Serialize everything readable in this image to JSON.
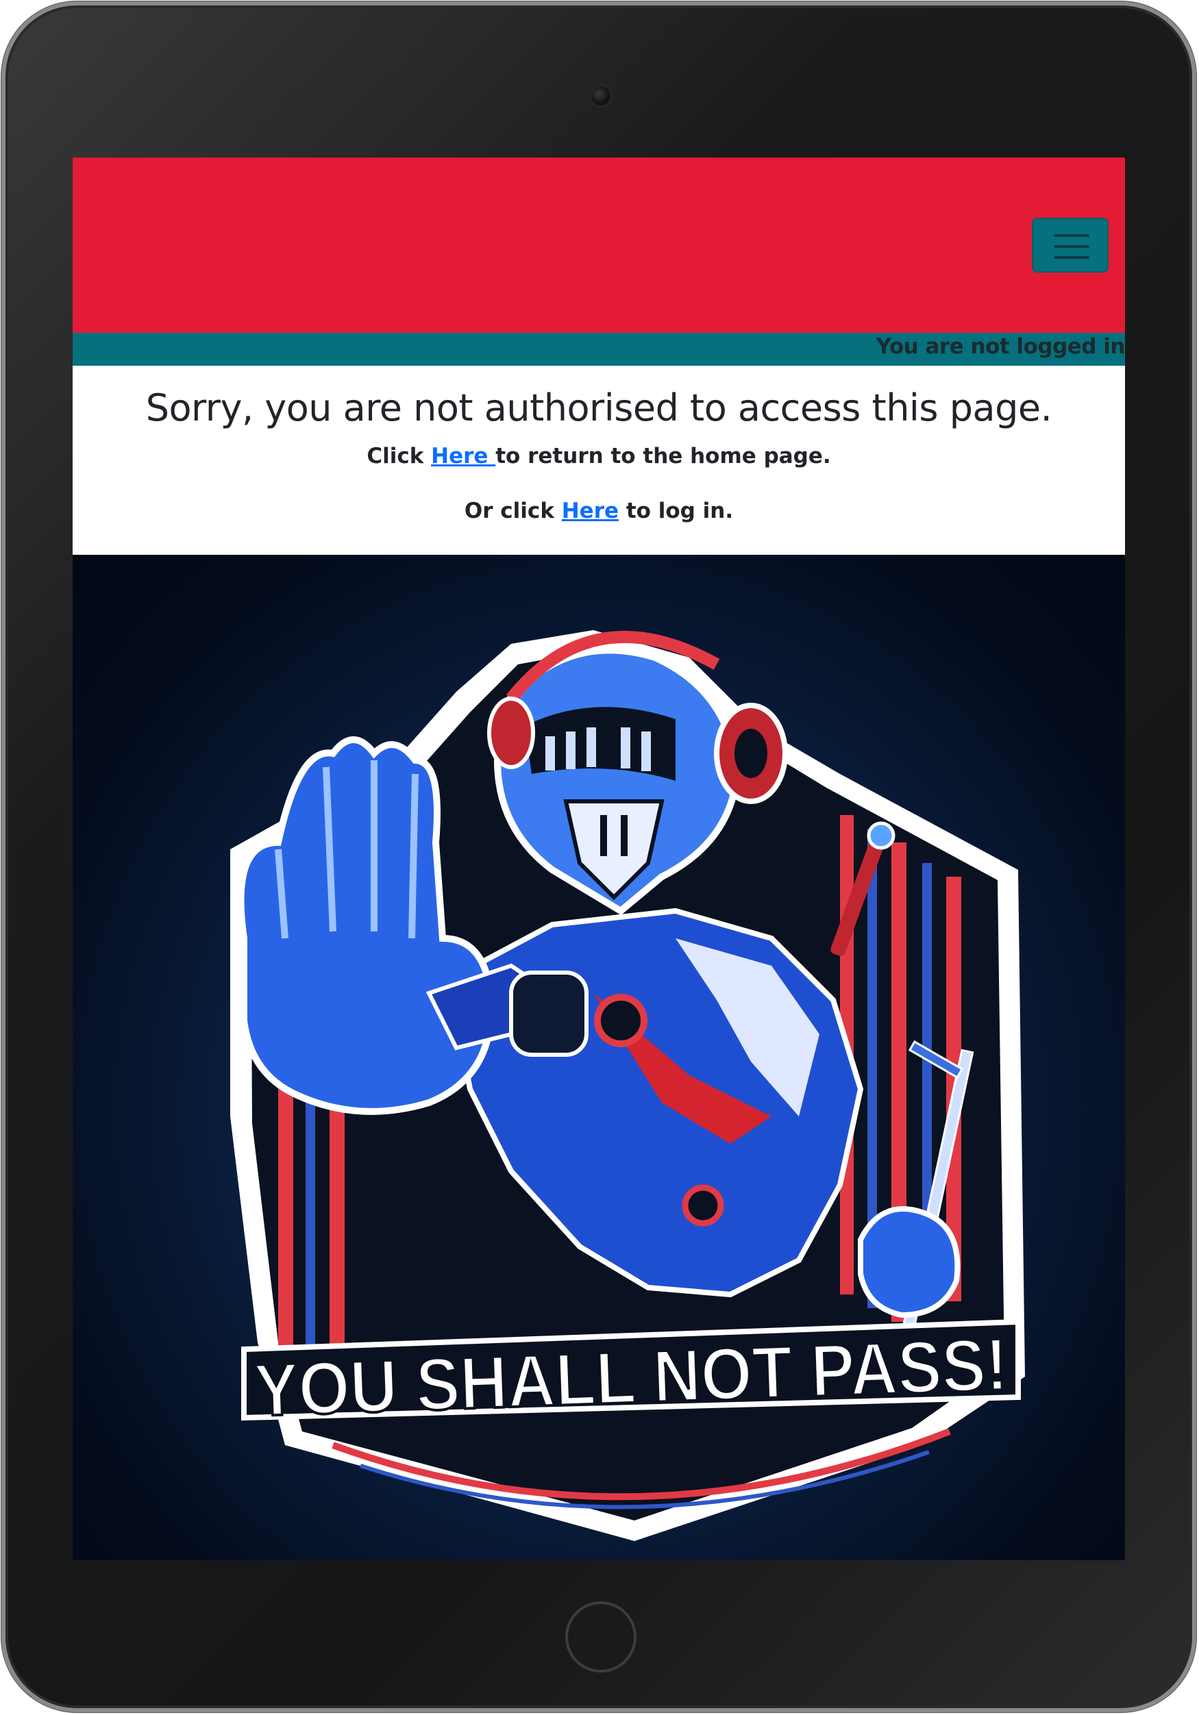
{
  "colors": {
    "header": "#e31b35",
    "accent": "#06707d",
    "link": "#0d6efd",
    "text": "#212529"
  },
  "navbar": {
    "toggle_icon": "hamburger-menu-icon",
    "status": "You are not logged in"
  },
  "message": {
    "title": "Sorry, you are not authorised to access this page.",
    "home_prefix": "Click ",
    "home_link": "Here ",
    "home_suffix": "to return to the home page.",
    "login_prefix": "Or click ",
    "login_link": "Here",
    "login_suffix": " to log in."
  },
  "hero": {
    "banner_text": "YOU SHALL NOT PASS!"
  }
}
